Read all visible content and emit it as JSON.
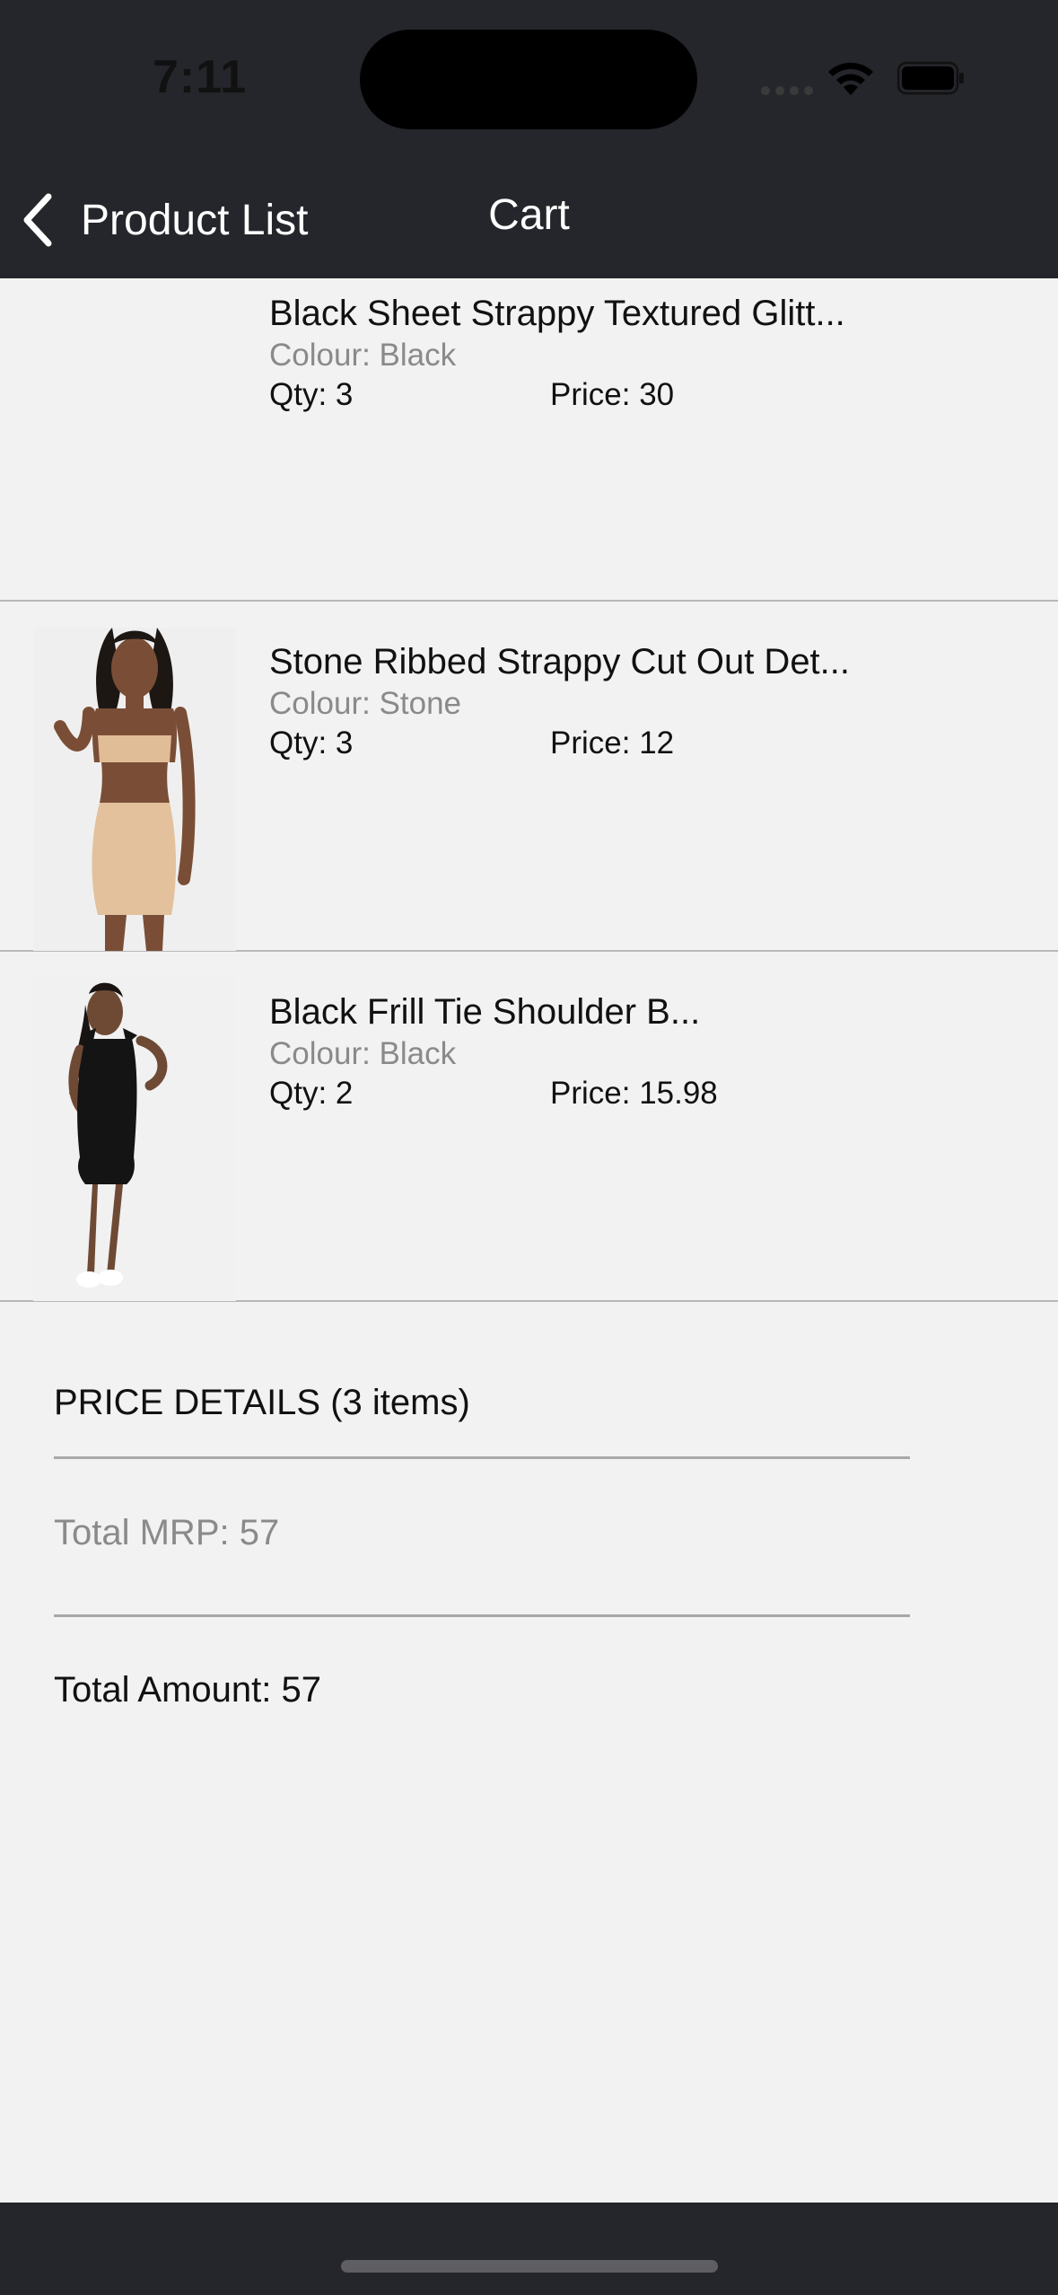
{
  "status_bar": {
    "time": "7:11"
  },
  "nav": {
    "back_label": "Product List",
    "title": "Cart"
  },
  "cart_items": [
    {
      "name": "Black Sheet Strappy Textured Glitt...",
      "colour": "Colour: Black",
      "qty": "Qty: 3",
      "price": "Price: 30",
      "image": "none"
    },
    {
      "name": "Stone Ribbed Strappy Cut Out Det...",
      "colour": "Colour: Stone",
      "qty": "Qty: 3",
      "price": "Price: 12",
      "image": "model-beige-two-piece"
    },
    {
      "name": "Black Frill Tie Shoulder B...",
      "colour": "Colour: Black",
      "qty": "Qty: 2",
      "price": "Price: 15.98",
      "image": "model-black-mini-dress"
    }
  ],
  "price_details": {
    "header": "PRICE DETAILS (3 items)",
    "total_mrp": "Total MRP: 57",
    "total_amount": "Total Amount: 57"
  },
  "colors": {
    "bar": "#25262b",
    "background": "#f2f2f2",
    "muted_text": "#8a8a8a"
  }
}
